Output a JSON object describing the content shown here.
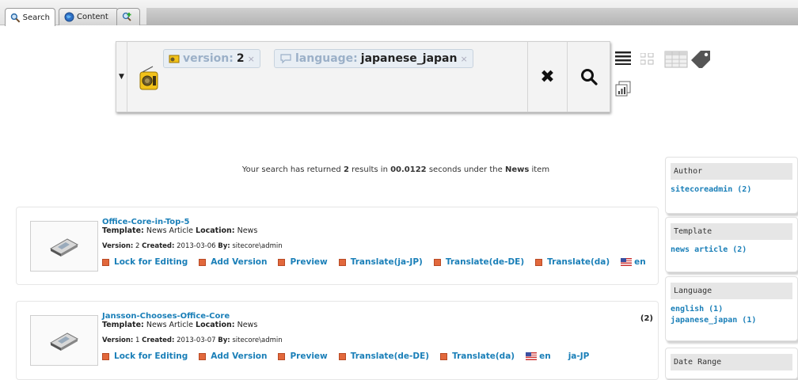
{
  "tabs": [
    {
      "label": "Search",
      "icon": "magnifier-icon"
    },
    {
      "label": "Content",
      "icon": "globe-icon"
    },
    {
      "label": "",
      "icon": "add-tab-icon"
    }
  ],
  "search": {
    "facets": [
      {
        "key": "version:",
        "value": "2"
      },
      {
        "key": "language:",
        "value": "japanese_japan"
      }
    ],
    "clear_icon": "✖",
    "search_icon": "search-icon"
  },
  "summary": {
    "prefix": "Your search has returned",
    "count": "2",
    "mid1": "results in",
    "time": "00.0122",
    "mid2": "seconds under the",
    "item": "News",
    "suffix": "item"
  },
  "results": [
    {
      "title": "Office-Core-in-Top-5",
      "template_label": "Template:",
      "template": "News Article",
      "location_label": "Location:",
      "location": "News",
      "version_label": "Version:",
      "version": "2",
      "created_label": "Created:",
      "created": "2013-03-06",
      "by_label": "By:",
      "by": "sitecore\\admin",
      "count": "",
      "actions": [
        "Lock for Editing",
        "Add Version",
        "Preview",
        "Translate(ja-JP)",
        "Translate(de-DE)",
        "Translate(da)"
      ],
      "languages": [
        "en"
      ]
    },
    {
      "title": "Jansson-Chooses-Office-Core",
      "template_label": "Template:",
      "template": "News Article",
      "location_label": "Location:",
      "location": "News",
      "version_label": "Version:",
      "version": "1",
      "created_label": "Created:",
      "created": "2013-03-07",
      "by_label": "By:",
      "by": "sitecore\\admin",
      "count": "(2)",
      "actions": [
        "Lock for Editing",
        "Add Version",
        "Preview",
        "Translate(de-DE)",
        "Translate(da)"
      ],
      "languages": [
        "en",
        "ja-JP"
      ]
    }
  ],
  "facet_panels": [
    {
      "heading": "Author",
      "items": [
        "sitecoreadmin (2)"
      ]
    },
    {
      "heading": "Template",
      "items": [
        "news article (2)"
      ]
    },
    {
      "heading": "Language",
      "items": [
        "english (1)",
        "japanese_japan (1)"
      ]
    },
    {
      "heading": "Date Range",
      "items": []
    }
  ],
  "colors": {
    "link": "#1a7fb8",
    "action_square": "#e2683c",
    "facet_key": "#9bb0c8"
  }
}
